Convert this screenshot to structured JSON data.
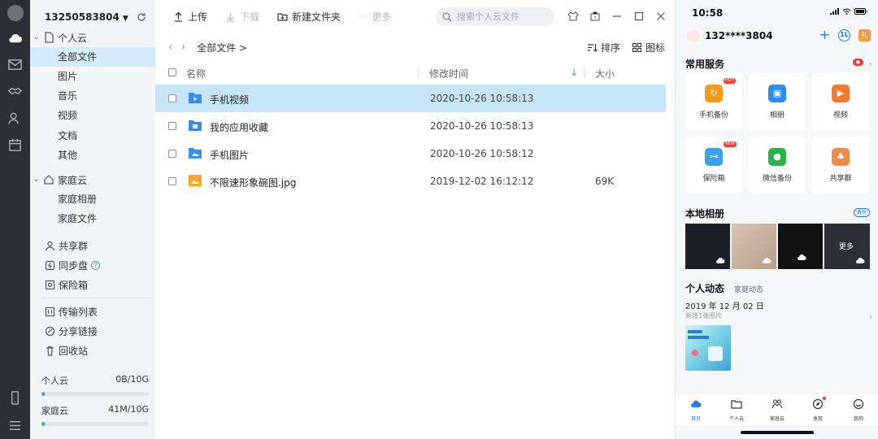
{
  "desktop": {
    "account": "13250583804",
    "toolbar": {
      "upload": "上传",
      "download": "下载",
      "new_folder": "新建文件夹",
      "more": "更多",
      "search_placeholder": "搜索个人云文件"
    },
    "sidebar": {
      "personal_cloud": "个人云",
      "personal_items": [
        "全部文件",
        "图片",
        "音乐",
        "视频",
        "文档",
        "其他"
      ],
      "family_cloud": "家庭云",
      "family_items": [
        "家庭相册",
        "家庭文件"
      ],
      "tools1": [
        "共享群",
        "同步盘",
        "保险箱"
      ],
      "tools2": [
        "传输列表",
        "分享链接",
        "回收站"
      ],
      "storage": [
        {
          "label": "个人云",
          "value": "0B/10G",
          "fill": 0.01
        },
        {
          "label": "家庭云",
          "value": "41M/10G",
          "fill": 0.01
        }
      ]
    },
    "breadcrumb": "全部文件 >",
    "view": {
      "sort": "排序",
      "icons": "图标"
    },
    "columns": {
      "name": "名称",
      "time": "修改时间",
      "size": "大小"
    },
    "files": [
      {
        "name": "手机视频",
        "time": "2020-10-26 10:58:13",
        "size": "",
        "type": "folder"
      },
      {
        "name": "我的应用收藏",
        "time": "2020-10-26 10:58:13",
        "size": "",
        "type": "folder"
      },
      {
        "name": "手机图片",
        "time": "2020-10-26 10:58:12",
        "size": "",
        "type": "folder"
      },
      {
        "name": "不限速形象碗图.jpg",
        "time": "2019-12-02 16:12:12",
        "size": "69K",
        "type": "image"
      }
    ]
  },
  "phone": {
    "time": "10:58",
    "phone_number": "132****3804",
    "gift_label": "礼",
    "common_services": "常用服务",
    "services": [
      {
        "label": "手机备份",
        "tag": "HOT",
        "color": "#f39a1b"
      },
      {
        "label": "相册",
        "tag": "",
        "color": "#2e8ef0"
      },
      {
        "label": "视频",
        "tag": "",
        "color": "#f57a2e"
      },
      {
        "label": "保险箱",
        "tag": "NEW",
        "color": "#3aa0f0"
      },
      {
        "label": "微信备份",
        "tag": "",
        "color": "#2cb34a"
      },
      {
        "label": "共享群",
        "tag": "",
        "color": "#f08a4b"
      }
    ],
    "local_album": "本地相册",
    "backup": "备份",
    "album_more": "更多",
    "tabs": {
      "personal": "个人动态",
      "family": "家庭动态"
    },
    "date": "2019 年 12 月 02 日",
    "new_pics": "新增1张图片",
    "bottom_nav": [
      "首页",
      "个人云",
      "家庭云",
      "发现",
      "我的"
    ]
  }
}
